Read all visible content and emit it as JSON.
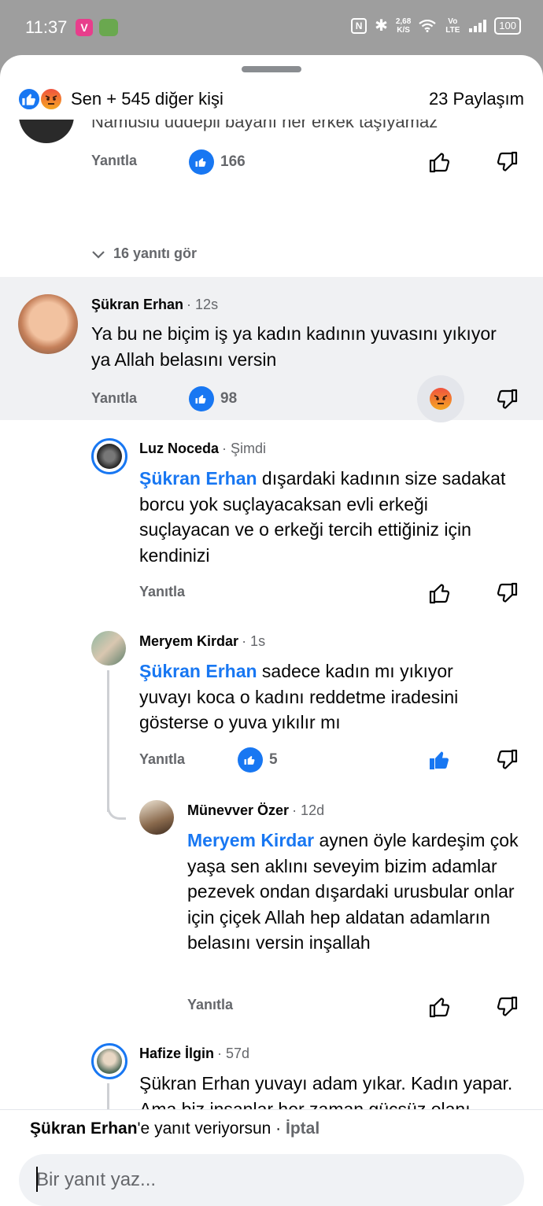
{
  "status_bar": {
    "time": "11:37",
    "speed_value": "2,68",
    "speed_unit": "K/S",
    "network": "Vo LTE",
    "battery": "100"
  },
  "header": {
    "summary": "Sen + 545 diğer kişi",
    "shares": "23 Paylaşım"
  },
  "comments": [
    {
      "id": "cut",
      "text_partial": "Namuslu uddepli bayanı her erkek taşıyamaz",
      "reply_label": "Yanıtla",
      "likes": "166",
      "view_replies": "16 yanıtı gör"
    },
    {
      "id": "sukran",
      "author": "Şükran Erhan",
      "time": "· 12s",
      "text": "Ya bu ne biçim iş ya kadın kadının yuvasını yıkıyor ya Allah belasını versin",
      "reply_label": "Yanıtla",
      "likes": "98"
    },
    {
      "id": "luz",
      "author": "Luz Noceda",
      "time": "· Şimdi",
      "mention": "Şükran Erhan",
      "text": " dışardaki kadının size sadakat borcu yok suçlayacaksan evli erkeği suçlayacan ve o erkeği tercih ettiğiniz için kendinizi",
      "reply_label": "Yanıtla"
    },
    {
      "id": "meryem",
      "author": "Meryem Kirdar",
      "time": "· 1s",
      "mention": "Şükran Erhan",
      "text": " sadece kadın mı yıkıyor yuvayı koca o kadını reddetme iradesini gösterse o yuva yıkılır mı",
      "reply_label": "Yanıtla",
      "likes": "5"
    },
    {
      "id": "munevver",
      "author": "Münevver Özer",
      "time": "· 12d",
      "mention": "Meryem Kirdar",
      "text": " aynen öyle kardeşim çok yaşa sen aklını seveyim bizim adamlar pezevek ondan dışardaki urusbular onlar için çiçek Allah hep aldatan adamların belasını versin inşallah",
      "reply_label": "Yanıtla"
    },
    {
      "id": "hafize",
      "author": "Hafize İlgin",
      "time": "· 57d",
      "text": "Şükran Erhan yuvayı adam yıkar. Kadın yapar. Ama biz insanlar her zaman güçsüz olanı suçlar."
    }
  ],
  "composer": {
    "replying_to": "Şükran Erhan",
    "replying_suffix": "'e yanıt veriyorsun",
    "separator": " · ",
    "cancel_label": "İptal",
    "placeholder": "Bir yanıt yaz..."
  },
  "colors": {
    "accent": "#1877f2",
    "muted": "#65676b",
    "highlight_bg": "#f0f1f3"
  }
}
